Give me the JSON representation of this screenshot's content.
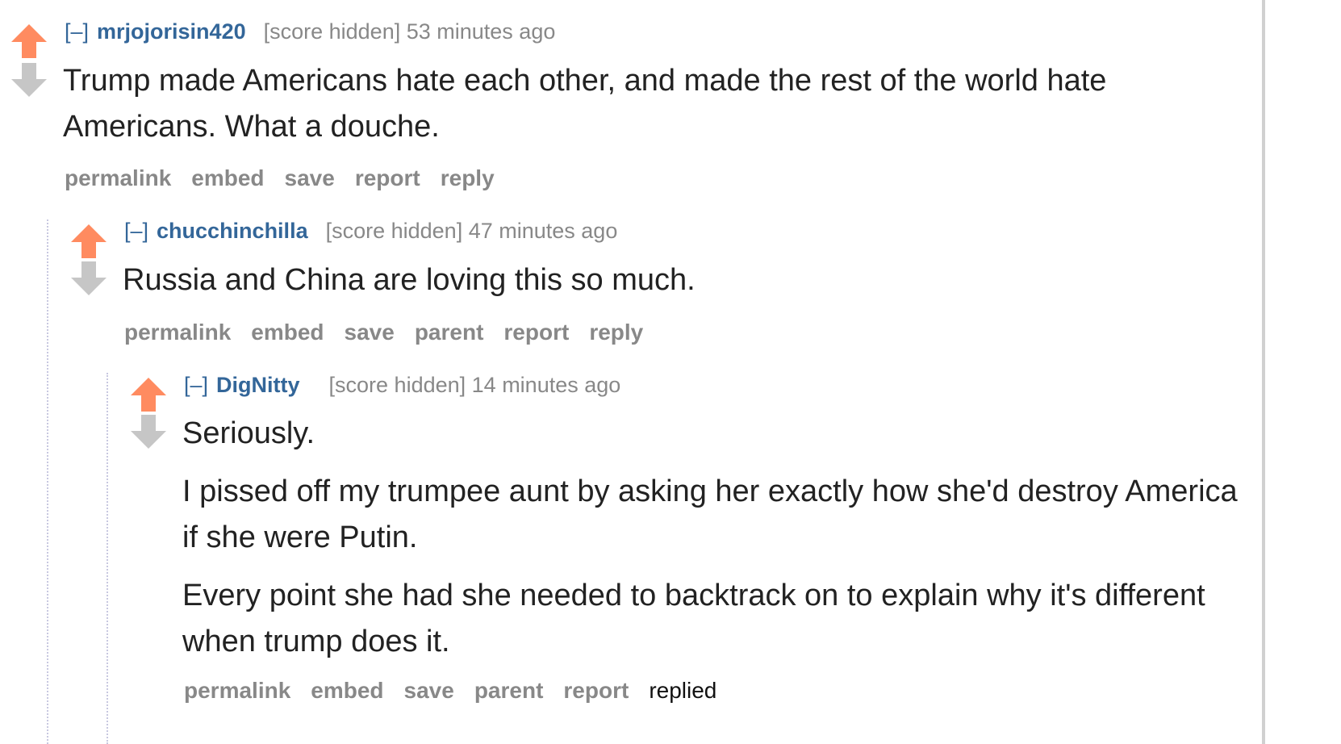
{
  "colors": {
    "upvote": "#ff8b60",
    "downvote": "#c6c6c6",
    "author": "#336699",
    "meta": "#888888",
    "text": "#222222"
  },
  "comments": [
    {
      "collapse_label": "[–]",
      "author": "mrjojorisin420",
      "score": "[score hidden]",
      "time": "53 minutes ago",
      "upvote_icon": "upvote-arrow",
      "downvote_icon": "downvote-arrow",
      "paragraphs": [
        "Trump made Americans hate each other, and made the rest of the world hate Americans. What a douche."
      ],
      "buttons": [
        "permalink",
        "embed",
        "save",
        "report",
        "reply"
      ]
    },
    {
      "collapse_label": "[–]",
      "author": "chucchinchilla",
      "score": "[score hidden]",
      "time": "47 minutes ago",
      "upvote_icon": "upvote-arrow",
      "downvote_icon": "downvote-arrow",
      "paragraphs": [
        "Russia and China are loving this so much."
      ],
      "buttons": [
        "permalink",
        "embed",
        "save",
        "parent",
        "report",
        "reply"
      ]
    },
    {
      "collapse_label": "[–]",
      "author": "DigNitty",
      "score": "[score hidden]",
      "time": "14 minutes ago",
      "upvote_icon": "upvote-arrow",
      "downvote_icon": "downvote-arrow",
      "paragraphs": [
        "Seriously.",
        "I pissed off my trumpee aunt by asking her exactly how she'd destroy America if she were Putin.",
        "Every point she had she needed to backtrack on to explain why it's different when trump does it."
      ],
      "buttons": [
        "permalink",
        "embed",
        "save",
        "parent",
        "report"
      ],
      "status": "replied"
    }
  ]
}
